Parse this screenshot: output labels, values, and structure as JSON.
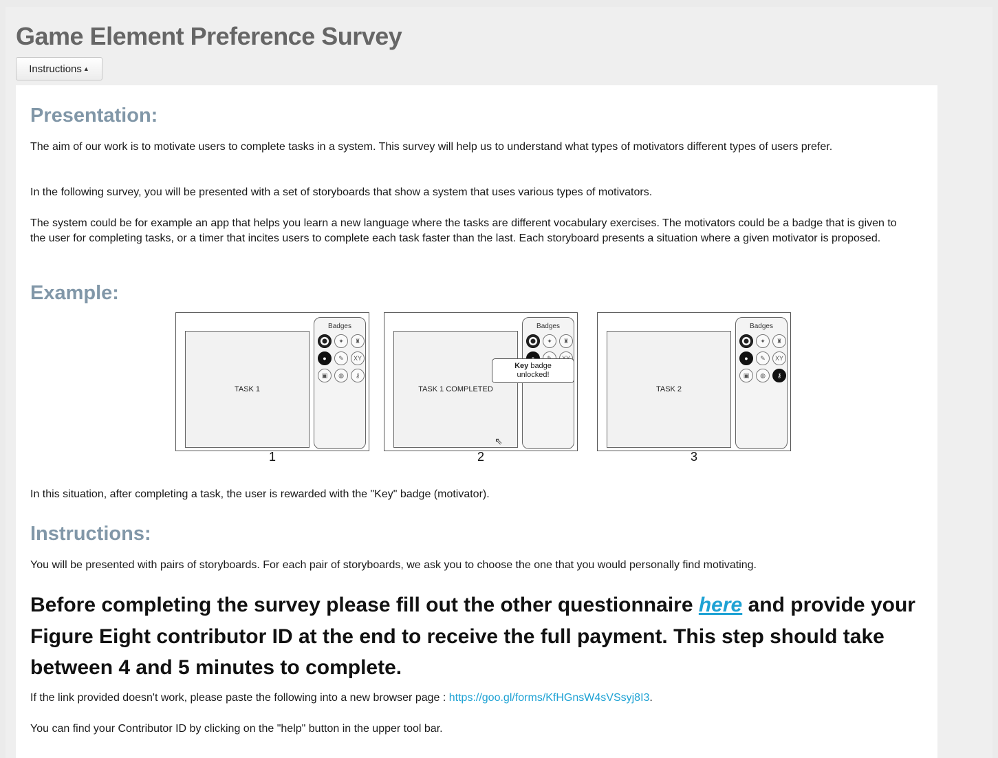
{
  "title": "Game Element Preference Survey",
  "instructions_button": {
    "label": "Instructions",
    "caret_icon": "caret-up-icon"
  },
  "presentation": {
    "heading": "Presentation:",
    "para1": "The aim of our work is to motivate users to complete tasks in a system. This survey will help us to understand what types of motivators different types of users prefer.",
    "para2": "In the following survey, you will be presented with a set of storyboards that show a system that uses various types of motivators.",
    "para3": "The system could be for example an app that helps you learn a new language where the tasks are different vocabulary exercises. The motivators could be a badge that is given to the user for completing tasks, or a timer that incites users to complete each task faster than the last. Each storyboard presents a situation where a given motivator is proposed."
  },
  "example": {
    "heading": "Example:",
    "storyboard": {
      "panel_title": "Badges",
      "frames": [
        {
          "number": "1",
          "screen_text": "TASK 1"
        },
        {
          "number": "2",
          "screen_text": "TASK 1 COMPLETED",
          "popup_bold": "Key",
          "popup_rest": " badge",
          "popup_line2": "unlocked!"
        },
        {
          "number": "3",
          "screen_text": "TASK 2"
        }
      ],
      "badge_glyphs": [
        "◎",
        "✦",
        "♜",
        "⬤",
        "✎",
        "XY",
        "▣",
        "◍",
        "⚷"
      ]
    },
    "caption": "In this situation, after completing a task, the user is rewarded with the \"Key\" badge (motivator)."
  },
  "instructions": {
    "heading": "Instructions:",
    "para": "You will be presented with pairs of storyboards. For each pair of storyboards, we ask you to choose the one that you would personally find motivating.",
    "big_before": "Before completing the survey please fill out the other questionnaire ",
    "big_link": "here",
    "big_after": " and provide your Figure Eight contributor ID at the end to receive the full payment. This step should take between 4 and 5 minutes to complete.",
    "fallback_prefix": "If the link provided doesn't work, please paste the following into a new browser page : ",
    "fallback_url": "https://goo.gl/forms/KfHGnsW4sVSsyj8I3",
    "fallback_suffix": ".",
    "contributor_note": "You can find your Contributor ID by clicking on the \"help\" button in the upper tool bar."
  }
}
